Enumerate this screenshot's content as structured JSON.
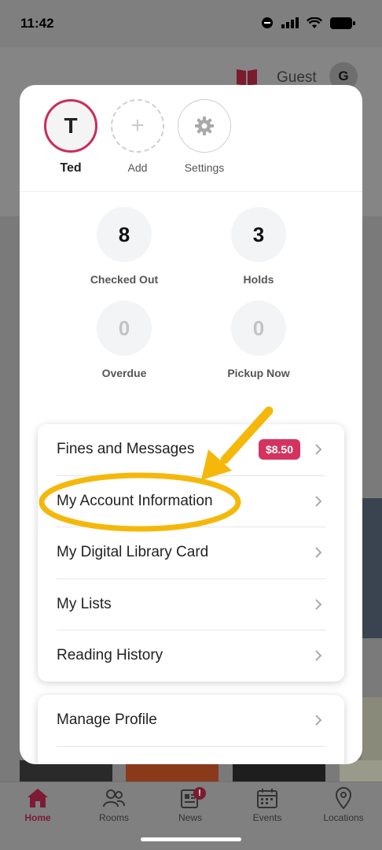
{
  "status_bar": {
    "time": "11:42"
  },
  "header": {
    "user_label": "Guest",
    "avatar_initial": "G"
  },
  "profiles": [
    {
      "label": "Ted",
      "initial": "T"
    },
    {
      "label": "Add",
      "glyph": "+"
    },
    {
      "label": "Settings",
      "icon": "gear-icon"
    }
  ],
  "stats": {
    "checked_out": {
      "value": "8",
      "label": "Checked Out"
    },
    "holds": {
      "value": "3",
      "label": "Holds"
    },
    "overdue": {
      "value": "0",
      "label": "Overdue"
    },
    "pickup_now": {
      "value": "0",
      "label": "Pickup Now"
    }
  },
  "menu": {
    "fines": {
      "label": "Fines and Messages",
      "badge": "$8.50"
    },
    "account_info": {
      "label": "My Account Information"
    },
    "digital_card": {
      "label": "My Digital Library Card"
    },
    "lists": {
      "label": "My Lists"
    },
    "reading_history": {
      "label": "Reading History"
    },
    "manage_profile": {
      "label": "Manage Profile"
    }
  },
  "tabs": {
    "home": "Home",
    "rooms": "Rooms",
    "news": "News",
    "news_badge": "!",
    "events": "Events",
    "locations": "Locations"
  },
  "colors": {
    "accent": "#c92d5b",
    "badge": "#d4335f",
    "highlight": "#f5b80a",
    "tab_active": "#7e1a35"
  }
}
